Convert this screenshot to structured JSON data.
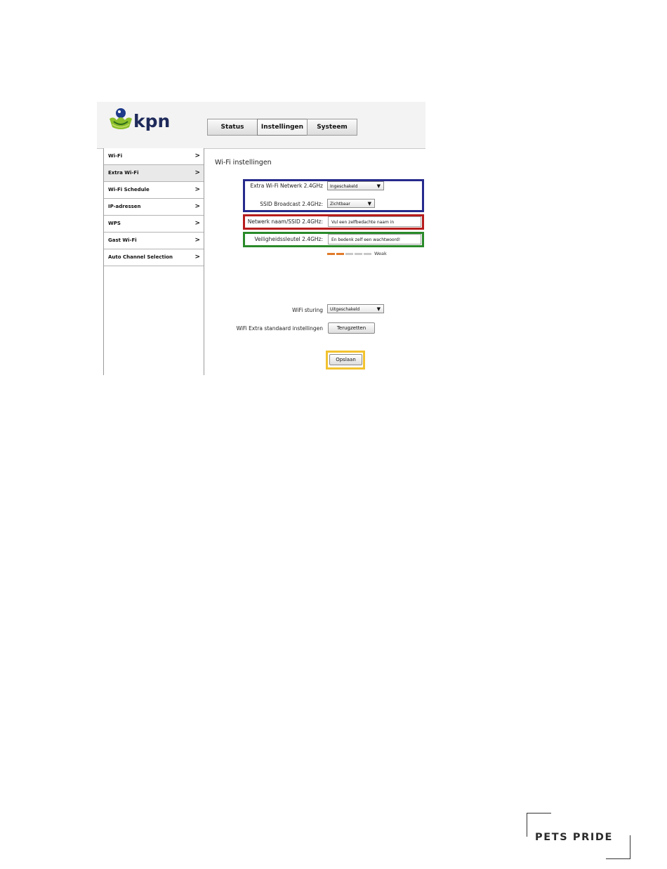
{
  "header": {
    "logo_text": "kpn",
    "tabs": [
      {
        "label": "Status"
      },
      {
        "label": "Instellingen"
      },
      {
        "label": "Systeem"
      }
    ],
    "active_tab": "Instellingen"
  },
  "sidebar": {
    "items": [
      {
        "label": "Wi-Fi"
      },
      {
        "label": "Extra Wi-Fi"
      },
      {
        "label": "Wi-Fi Schedule"
      },
      {
        "label": "IP-adressen"
      },
      {
        "label": "WPS"
      },
      {
        "label": "Gast Wi-Fi"
      },
      {
        "label": "Auto Channel Selection"
      }
    ],
    "active_item": "Extra Wi-Fi",
    "arrow_glyph": ">"
  },
  "main": {
    "title": "Wi-Fi instellingen",
    "extra_wifi": {
      "label": "Extra Wi-Fi Netwerk 2.4GHz",
      "value": "Ingeschakeld"
    },
    "ssid_broadcast": {
      "label": "SSID Broadcast 2.4GHz:",
      "value": "Zichtbaar"
    },
    "network_name": {
      "label": "Netwerk naam/SSID 2.4GHz:",
      "value": "Vul een zelfbedachte naam in"
    },
    "security_key": {
      "label": "Veiligheidssleutel 2.4GHz:",
      "value": "En bedenk zelf een wachtwoord!"
    },
    "strength": {
      "label": "Weak",
      "level_fraction": 0.4,
      "color_on": "#e07a2b",
      "color_off": "#c8c8c8"
    },
    "wifi_sturing": {
      "label": "WiFi sturing",
      "value": "Uitgeschakeld"
    },
    "defaults": {
      "label": "WiFi Extra standaard instellingen",
      "button": "Terugzetten"
    },
    "save_button": "Opslaan"
  },
  "highlights": {
    "blue": "#262a8c",
    "red": "#b71c1c",
    "green": "#2a8a2a",
    "yellow": "#f2c230"
  },
  "brand": {
    "text": "PETS PRIDE"
  }
}
